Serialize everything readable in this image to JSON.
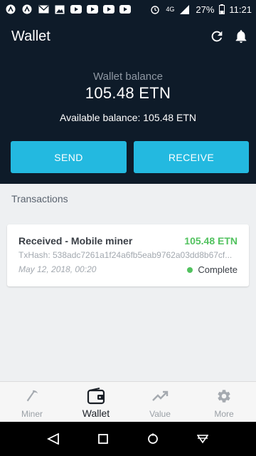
{
  "status_bar": {
    "network": "4G",
    "battery": "27%",
    "time": "11:21",
    "notification_icons": [
      "app-icon",
      "app-icon",
      "gmail-icon",
      "image-icon",
      "youtube-icon",
      "youtube-icon",
      "youtube-icon",
      "youtube-icon"
    ]
  },
  "header": {
    "title": "Wallet",
    "balance_label": "Wallet balance",
    "balance_value": "105.48 ETN",
    "available_balance": "Available balance: 105.48 ETN",
    "send_label": "SEND",
    "receive_label": "RECEIVE"
  },
  "transactions": {
    "heading": "Transactions",
    "items": [
      {
        "title": "Received - Mobile miner",
        "amount": "105.48 ETN",
        "hash": "TxHash: 538adc7261a1f24a6fb5eab9762a03dd8b67cf...",
        "date": "May 12, 2018, 00:20",
        "status": "Complete"
      }
    ]
  },
  "bottom_nav": {
    "items": [
      {
        "label": "Miner",
        "icon": "pickaxe-icon"
      },
      {
        "label": "Wallet",
        "icon": "wallet-icon"
      },
      {
        "label": "Value",
        "icon": "trending-up-icon"
      },
      {
        "label": "More",
        "icon": "gear-icon"
      }
    ],
    "active": "Wallet"
  },
  "colors": {
    "header_bg": "#0e1b29",
    "accent": "#23b9e0",
    "positive": "#52c25f"
  }
}
